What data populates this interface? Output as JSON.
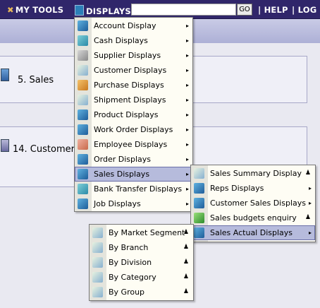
{
  "topbar": {
    "my_tools": "MY TOOLS",
    "displays": "DISPLAYS",
    "search_value": "",
    "go_label": "GO",
    "help": "| HELP",
    "log_off": "| LOG O"
  },
  "panels": {
    "sales": "5. Sales",
    "customer": "14. Customer"
  },
  "displays_menu": {
    "items": [
      {
        "label": "Account Display",
        "icon": "ledger-icon"
      },
      {
        "label": "Cash Displays",
        "icon": "cash-icon"
      },
      {
        "label": "Supplier Displays",
        "icon": "supplier-icon"
      },
      {
        "label": "Customer Displays",
        "icon": "customer-icon"
      },
      {
        "label": "Purchase Displays",
        "icon": "purchase-icon"
      },
      {
        "label": "Shipment Displays",
        "icon": "shipment-icon"
      },
      {
        "label": "Product Displays",
        "icon": "product-icon"
      },
      {
        "label": "Work Order Displays",
        "icon": "work-order-icon"
      },
      {
        "label": "Employee Displays",
        "icon": "employee-icon"
      },
      {
        "label": "Order Displays",
        "icon": "order-icon"
      },
      {
        "label": "Sales Displays",
        "icon": "sales-icon",
        "active": true
      },
      {
        "label": "Bank Transfer Displays",
        "icon": "bank-transfer-icon"
      },
      {
        "label": "Job Displays",
        "icon": "job-icon"
      }
    ]
  },
  "sales_menu": {
    "items": [
      {
        "label": "Sales Summary Display",
        "icon": "chart-icon",
        "marker": "person"
      },
      {
        "label": "Reps Displays",
        "icon": "reps-icon",
        "marker": "arrow"
      },
      {
        "label": "Customer Sales Displays",
        "icon": "customer-sales-icon",
        "marker": "arrow"
      },
      {
        "label": "Sales budgets enquiry",
        "icon": "monitor-icon",
        "marker": "person"
      },
      {
        "label": "Sales Actual Displays",
        "icon": "sales-actual-icon",
        "marker": "arrow",
        "active": true
      }
    ]
  },
  "sales_actual_menu": {
    "items": [
      {
        "label": "By Market Segment"
      },
      {
        "label": "By Branch"
      },
      {
        "label": "By Division"
      },
      {
        "label": "By Category"
      },
      {
        "label": "By Group"
      }
    ]
  },
  "glyphs": {
    "arrow": "▸",
    "person": "♟"
  },
  "colors": {
    "topbar": "#30266a",
    "menu_bg": "#fefdf4",
    "highlight": "#b6bbdc"
  }
}
